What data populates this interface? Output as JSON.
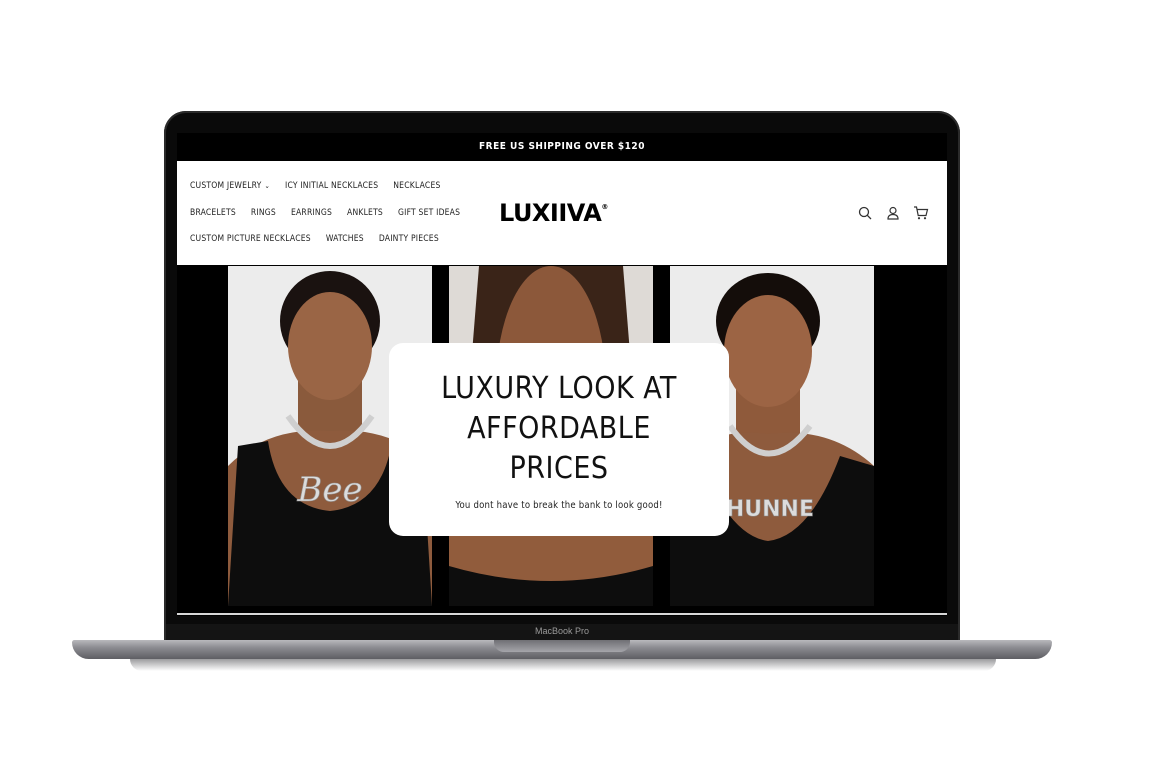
{
  "announcement": {
    "text": "FREE US SHIPPING OVER $120"
  },
  "header": {
    "logo": "LUXIIVA",
    "logo_mark": "®",
    "nav_rows": [
      [
        "CUSTOM JEWELRY",
        "ICY INITIAL NECKLACES",
        "NECKLACES"
      ],
      [
        "BRACELETS",
        "RINGS",
        "EARRINGS",
        "ANKLETS",
        "GIFT SET IDEAS"
      ],
      [
        "CUSTOM PICTURE NECKLACES",
        "WATCHES",
        "DAINTY PIECES"
      ]
    ],
    "icons": [
      "search-icon",
      "account-icon",
      "cart-icon"
    ]
  },
  "hero": {
    "title": "LUXURY LOOK AT AFFORDABLE PRICES",
    "subtitle": "You dont have to break the bank to look good!",
    "necklace_1_text": "Bee",
    "necklace_3_text": "SHUNNE"
  },
  "device": {
    "model": "MacBook Pro"
  },
  "colors": {
    "bar": "#000000",
    "header_bg": "#ffffff",
    "text": "#111111"
  }
}
